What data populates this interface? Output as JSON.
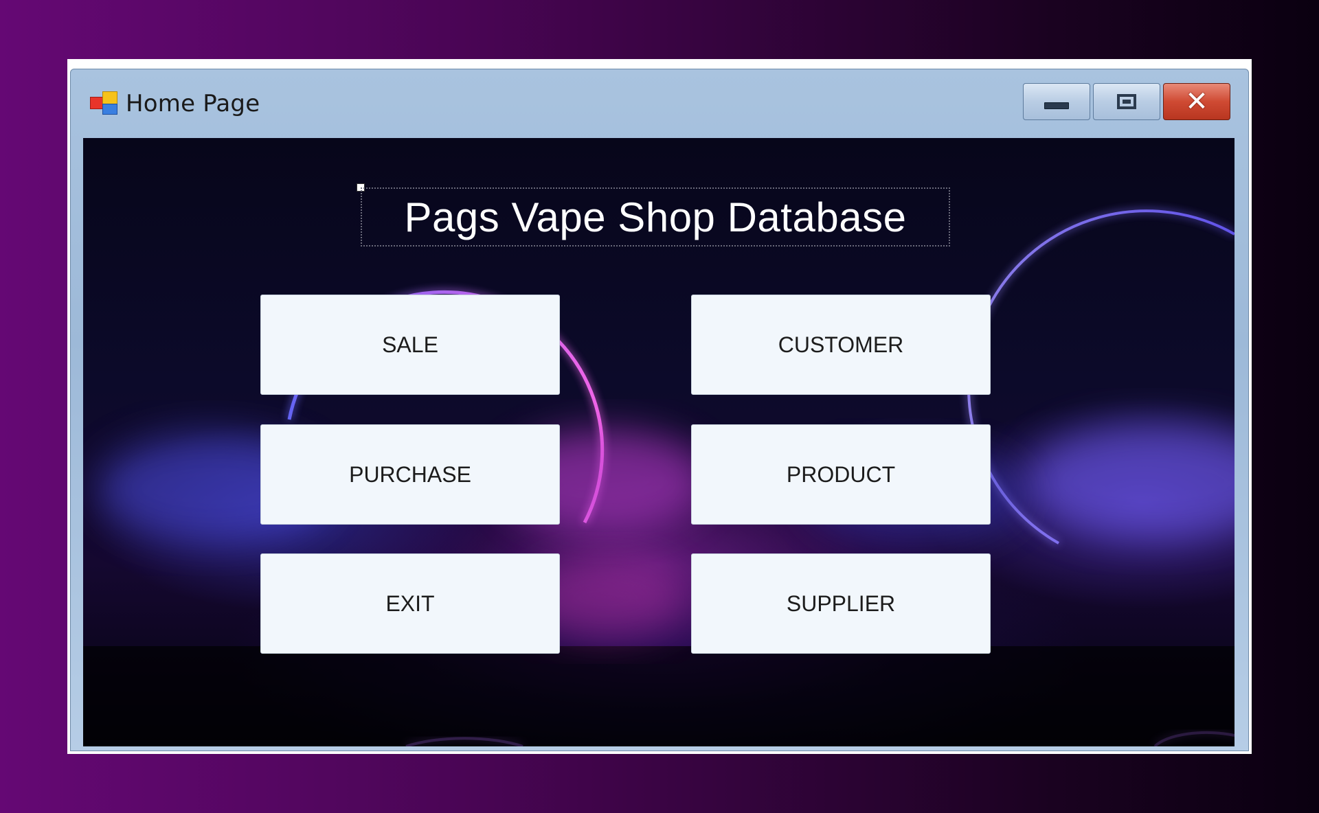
{
  "window": {
    "title": "Home Page",
    "controls": {
      "minimize": "minimize",
      "maximize": "maximize",
      "close": "close"
    }
  },
  "header": {
    "title": "Pags Vape Shop Database"
  },
  "menu": {
    "sale": "SALE",
    "customer": "CUSTOMER",
    "purchase": "PURCHASE",
    "product": "PRODUCT",
    "exit": "EXIT",
    "supplier": "SUPPLIER"
  },
  "icons": {
    "app": "windows-forms-app-icon",
    "minimize": "minimize-icon",
    "maximize": "maximize-icon",
    "close": "close-icon"
  },
  "colors": {
    "page_background": "#650874",
    "neon_pink": "#ff5cf0",
    "neon_blue": "#5a7bff",
    "button_face": "#f2f7fc",
    "close_button": "#cf4a33"
  }
}
